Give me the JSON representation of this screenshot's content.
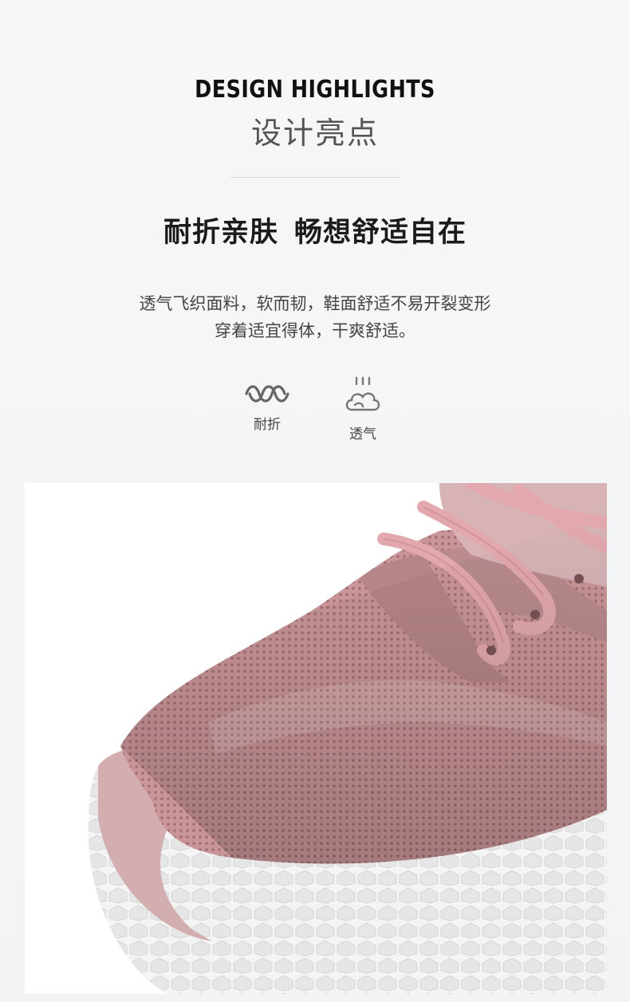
{
  "header": {
    "eyebrow": "DESIGN HIGHLIGHTS",
    "subtitle": "设计亮点"
  },
  "headline": {
    "part1": "耐折亲肤",
    "part2": "畅想舒适自在"
  },
  "description": {
    "line1": "透气飞织面料，软而韧，鞋面舒适不易开裂变形",
    "line2": "穿着适宜得体，干爽舒适。"
  },
  "features": [
    {
      "label": "耐折",
      "icon": "flex-wave-icon"
    },
    {
      "label": "透气",
      "icon": "breathable-cloud-icon"
    }
  ],
  "colors": {
    "background": "#f3f4f6",
    "shoe_pink": "#c89a9c",
    "shoe_dark_pink": "#a87c80",
    "sole_white": "#f5f5f5",
    "text_dark": "#1b1b1b",
    "text_gray": "#555555"
  }
}
